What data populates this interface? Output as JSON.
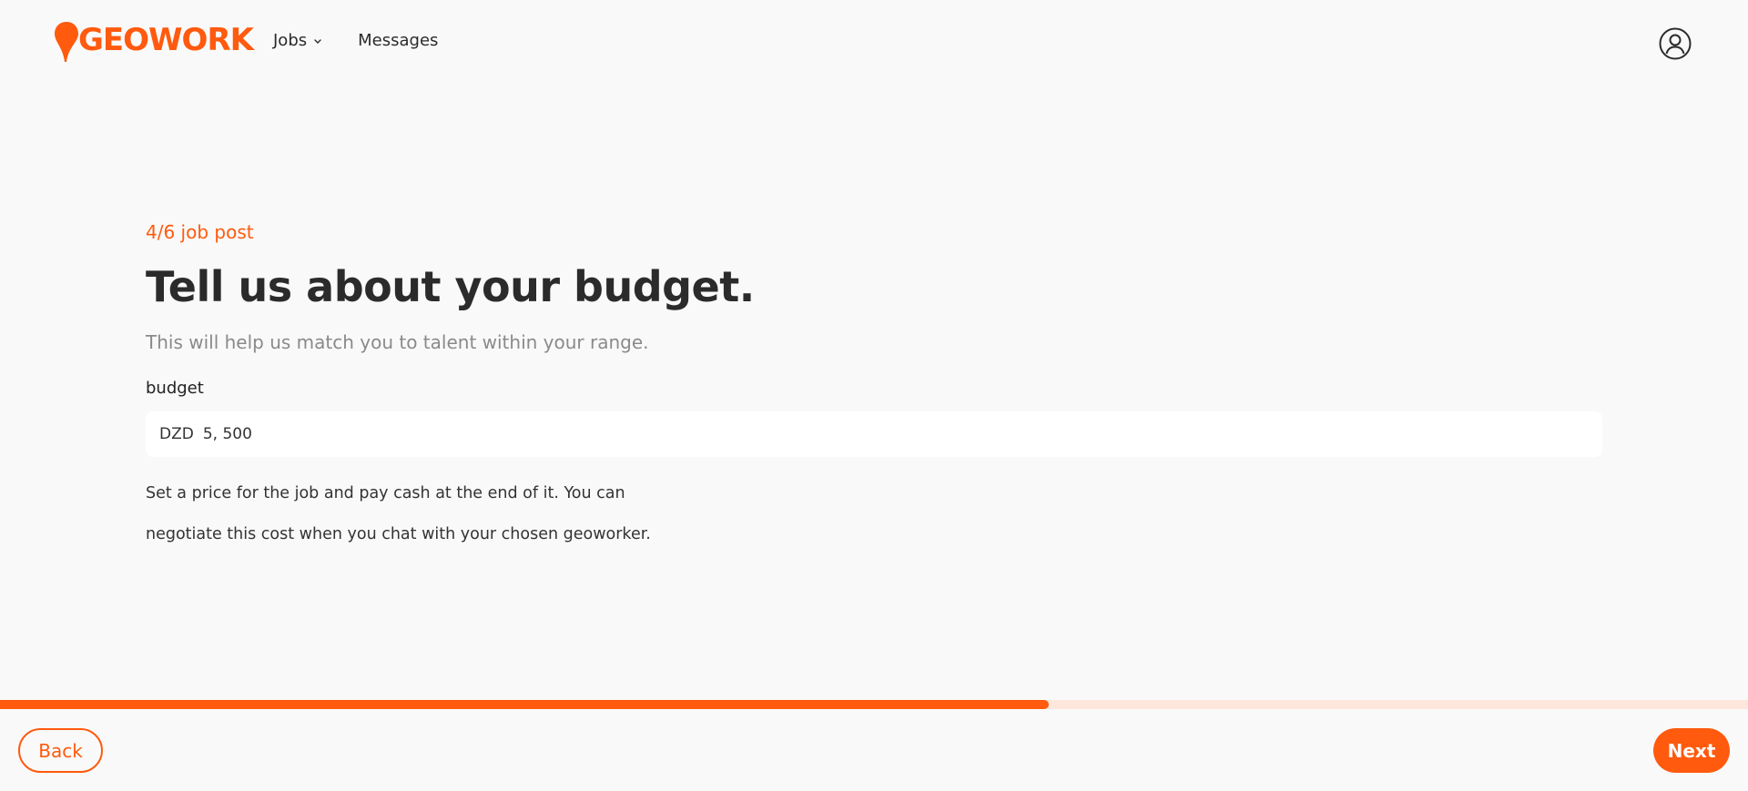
{
  "brand": {
    "logo_text": "GEOWORK",
    "accent_color": "#ff5a0e"
  },
  "nav": {
    "jobs_label": "Jobs",
    "messages_label": "Messages"
  },
  "icons": {
    "account": "user-circle-icon",
    "jobs_dropdown": "chevron-down-icon",
    "logo_pin": "map-pin-icon"
  },
  "main": {
    "step": "4/6 job post",
    "title": "Tell us about your budget.",
    "subtitle": "This will help us match you to talent within your range.",
    "budget_label": "budget",
    "currency": "DZD",
    "budget_value": "5, 500",
    "help_line1": "Set a price for the job and pay cash at the end of it. You can",
    "help_line2": "negotiate this cost when you chat with your chosen geoworker."
  },
  "progress": {
    "value": 0.6
  },
  "footer": {
    "back_label": "Back",
    "next_label": "Next"
  }
}
